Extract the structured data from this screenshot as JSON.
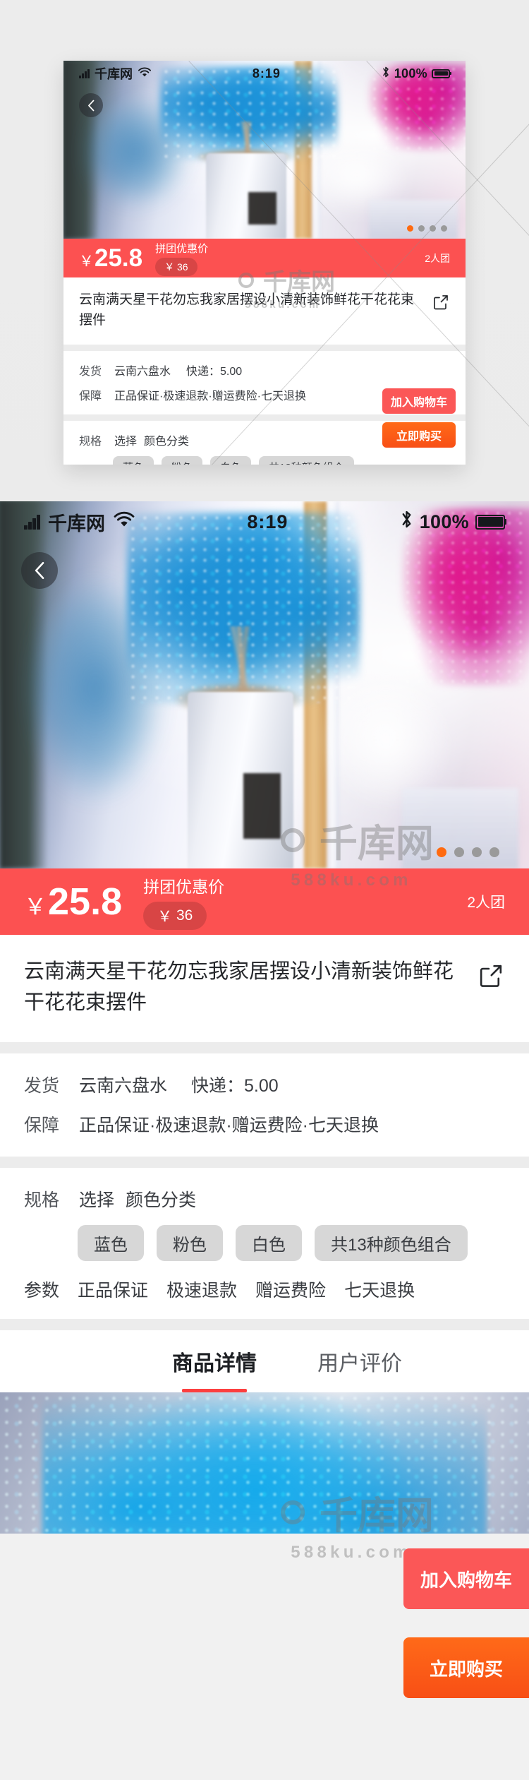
{
  "colors": {
    "price_bar_bg": "#fc5151",
    "cart_button_bg": "#fb5757",
    "buy_button_bg": "#ff6a18",
    "tab_active_underline": "#fc3f3f",
    "dot_active": "#ff6a0f",
    "dot_inactive": "#9a9a9a",
    "chip_bg": "#d7d7d7",
    "page_bg": "#ececec"
  },
  "status_bar": {
    "signal_icon": "signal-bars-icon",
    "carrier": "千库网",
    "wifi_icon": "wifi-icon",
    "time": "8:19",
    "bluetooth_icon": "bluetooth-icon",
    "battery_percent": "100%",
    "battery_icon": "battery-full-icon"
  },
  "hero": {
    "back_icon": "chevron-left-icon",
    "carousel_total": 4,
    "carousel_active_index": 0
  },
  "price_bar": {
    "currency": "￥",
    "price": "25.8",
    "promo_label": "拼团优惠价",
    "original_currency": "￥",
    "original_price": "36",
    "group_size": "2人团"
  },
  "product": {
    "title": "云南满天星干花勿忘我家居摆设小清新装饰鲜花干花花束摆件",
    "share_icon": "share-external-icon"
  },
  "shipping": {
    "rows": [
      {
        "key": "发货",
        "value": "云南六盘水",
        "extra": "快递：5.00"
      },
      {
        "key": "保障",
        "value": "正品保证·极速退款·赠运费险·七天退换",
        "extra": ""
      }
    ]
  },
  "spec": {
    "key": "规格",
    "action": "选择",
    "category": "颜色分类",
    "chips": [
      "蓝色",
      "粉色",
      "白色",
      "共13种颜色组合"
    ],
    "params_key": "参数",
    "params": [
      "正品保证",
      "极速退款",
      "赠运费险",
      "七天退换"
    ]
  },
  "tabs": {
    "items": [
      {
        "label": "商品详情",
        "active": true
      },
      {
        "label": "用户评价",
        "active": false
      }
    ]
  },
  "actions": {
    "add_to_cart": "加入购物车",
    "buy_now": "立即购买"
  },
  "watermark": {
    "logo_icon": "qianku-logo-icon",
    "brand": "千库网",
    "domain": "588ku.com"
  }
}
